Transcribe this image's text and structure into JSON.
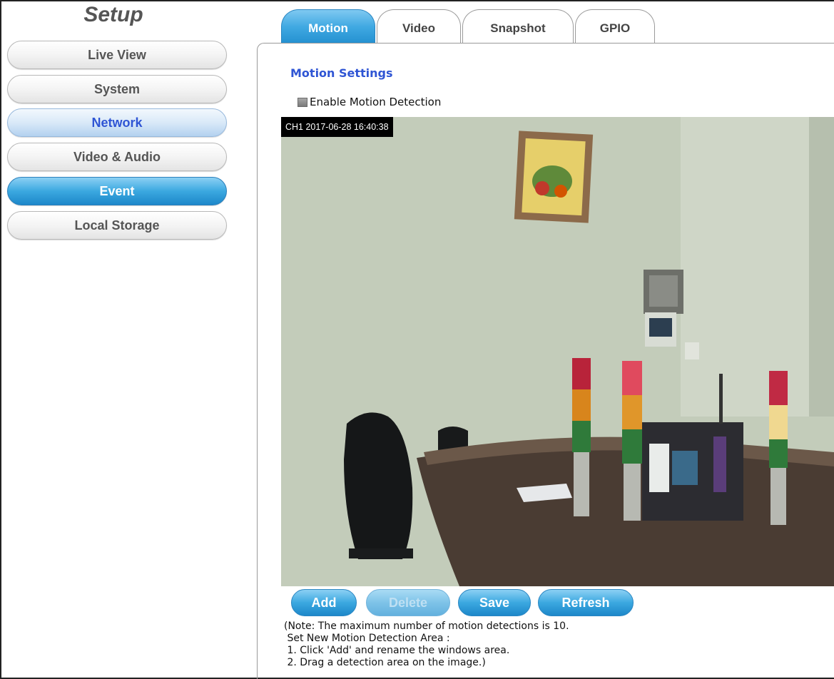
{
  "sidebar": {
    "title": "Setup",
    "items": [
      {
        "label": "Live View"
      },
      {
        "label": "System"
      },
      {
        "label": "Network"
      },
      {
        "label": "Video & Audio"
      },
      {
        "label": "Event"
      },
      {
        "label": "Local Storage"
      }
    ],
    "highlighted": "Network",
    "active": "Event"
  },
  "tabs": [
    {
      "label": "Motion"
    },
    {
      "label": "Video"
    },
    {
      "label": "Snapshot"
    },
    {
      "label": "GPIO"
    }
  ],
  "active_tab": "Motion",
  "main": {
    "section_title": "Motion Settings",
    "enable_label": "Enable Motion Detection",
    "camera": {
      "timestamp": "CH1 2017-06-28 16:40:38"
    },
    "buttons": {
      "add": "Add",
      "delete": "Delete",
      "save": "Save",
      "refresh": "Refresh"
    },
    "note": {
      "line1": "(Note: The maximum number of motion detections is 10.",
      "line2": " Set New Motion Detection Area :",
      "line3": " 1. Click 'Add' and rename the windows area.",
      "line4": " 2. Drag a detection area on the image.)"
    }
  },
  "colors": {
    "accent": "#2f55d4",
    "button_blue": "#3ba8e0"
  }
}
